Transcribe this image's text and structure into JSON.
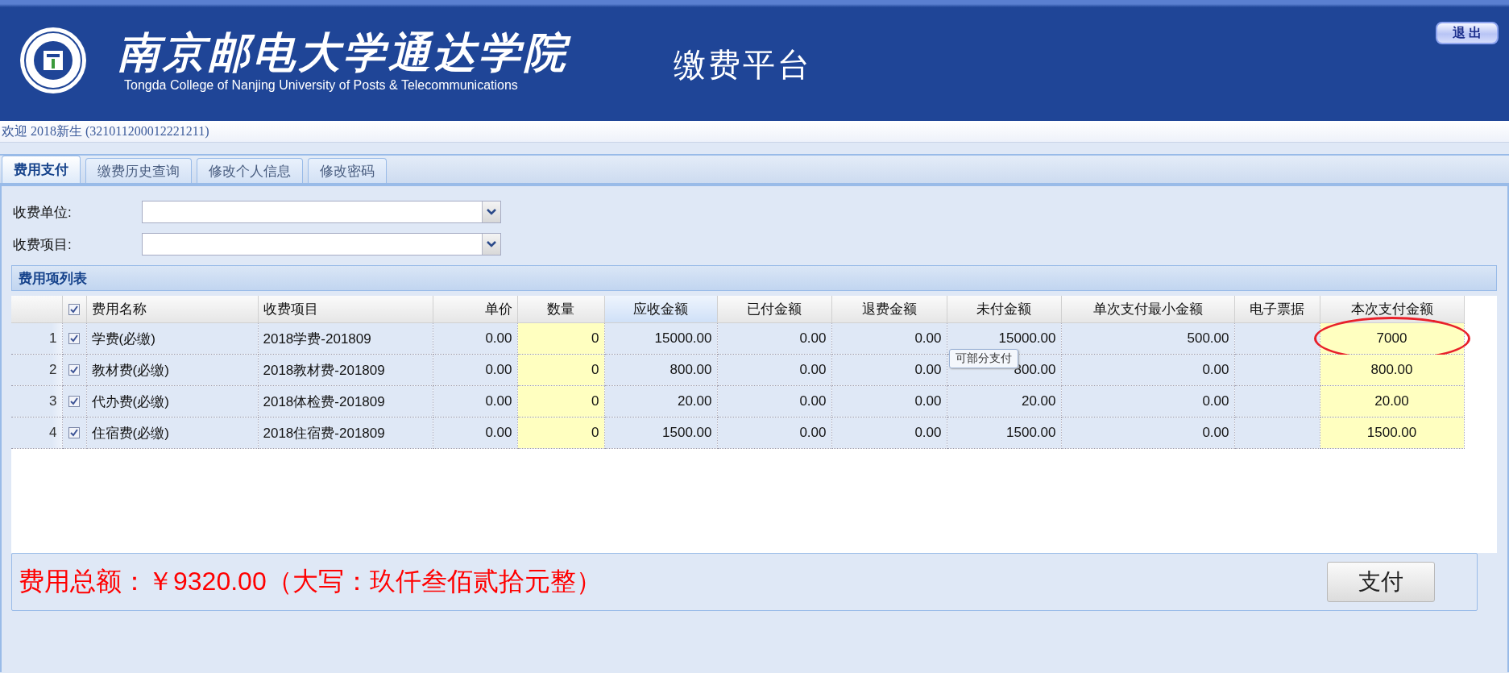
{
  "header": {
    "wordmark": "南京邮电大学通达学院",
    "subtitle": "Tongda College of Nanjing University of Posts & Telecommunications",
    "platform": "缴费平台",
    "logout": "退 出"
  },
  "welcome": "欢迎 2018新生 (321011200012221211)",
  "tabs": [
    {
      "label": "费用支付",
      "selected": true
    },
    {
      "label": "缴费历史查询",
      "selected": false
    },
    {
      "label": "修改个人信息",
      "selected": false
    },
    {
      "label": "修改密码",
      "selected": false
    }
  ],
  "filters": [
    {
      "label": "收费单位:"
    },
    {
      "label": "收费项目:"
    }
  ],
  "fee_list": {
    "title": "费用项列表",
    "header_checked": true,
    "columns": [
      {
        "kind": "text",
        "title": "费用名称",
        "highlighted": false
      },
      {
        "kind": "text",
        "title": "收费项目",
        "highlighted": false
      },
      {
        "kind": "text",
        "title": "单价",
        "highlighted": false
      },
      {
        "kind": "input",
        "title": "数量",
        "highlighted": false
      },
      {
        "kind": "text",
        "title": "应收金额",
        "highlighted": true
      },
      {
        "kind": "text",
        "title": "已付金额",
        "highlighted": false
      },
      {
        "kind": "text",
        "title": "退费金额",
        "highlighted": false
      },
      {
        "kind": "text",
        "title": "未付金额",
        "highlighted": false
      },
      {
        "kind": "text",
        "title": "单次支付最小金额",
        "highlighted": false
      },
      {
        "kind": "blank",
        "title": "电子票据",
        "highlighted": false
      },
      {
        "kind": "input",
        "title": "本次支付金额",
        "highlighted": false
      }
    ],
    "rows": [
      {
        "number": "1",
        "checked": true,
        "circled": true,
        "cells": [
          "学费(必缴)",
          "2018学费-201809",
          "0.00",
          "0",
          "15000.00",
          "0.00",
          "0.00",
          "15000.00",
          "500.00",
          "7000"
        ]
      },
      {
        "number": "2",
        "checked": true,
        "circled": false,
        "cells": [
          "教材费(必缴)",
          "2018教材费-201809",
          "0.00",
          "0",
          "800.00",
          "0.00",
          "0.00",
          "800.00",
          "0.00",
          "800.00"
        ]
      },
      {
        "number": "3",
        "checked": true,
        "circled": false,
        "cells": [
          "代办费(必缴)",
          "2018体检费-201809",
          "0.00",
          "0",
          "20.00",
          "0.00",
          "0.00",
          "20.00",
          "0.00",
          "20.00"
        ]
      },
      {
        "number": "4",
        "checked": true,
        "circled": false,
        "cells": [
          "住宿费(必缴)",
          "2018住宿费-201809",
          "0.00",
          "0",
          "1500.00",
          "0.00",
          "0.00",
          "1500.00",
          "0.00",
          "1500.00"
        ]
      }
    ],
    "tooltip": "可部分支付"
  },
  "total": "费用总额：￥9320.00（大写：玖仟叁佰贰拾元整）",
  "pay_button": "支付"
}
